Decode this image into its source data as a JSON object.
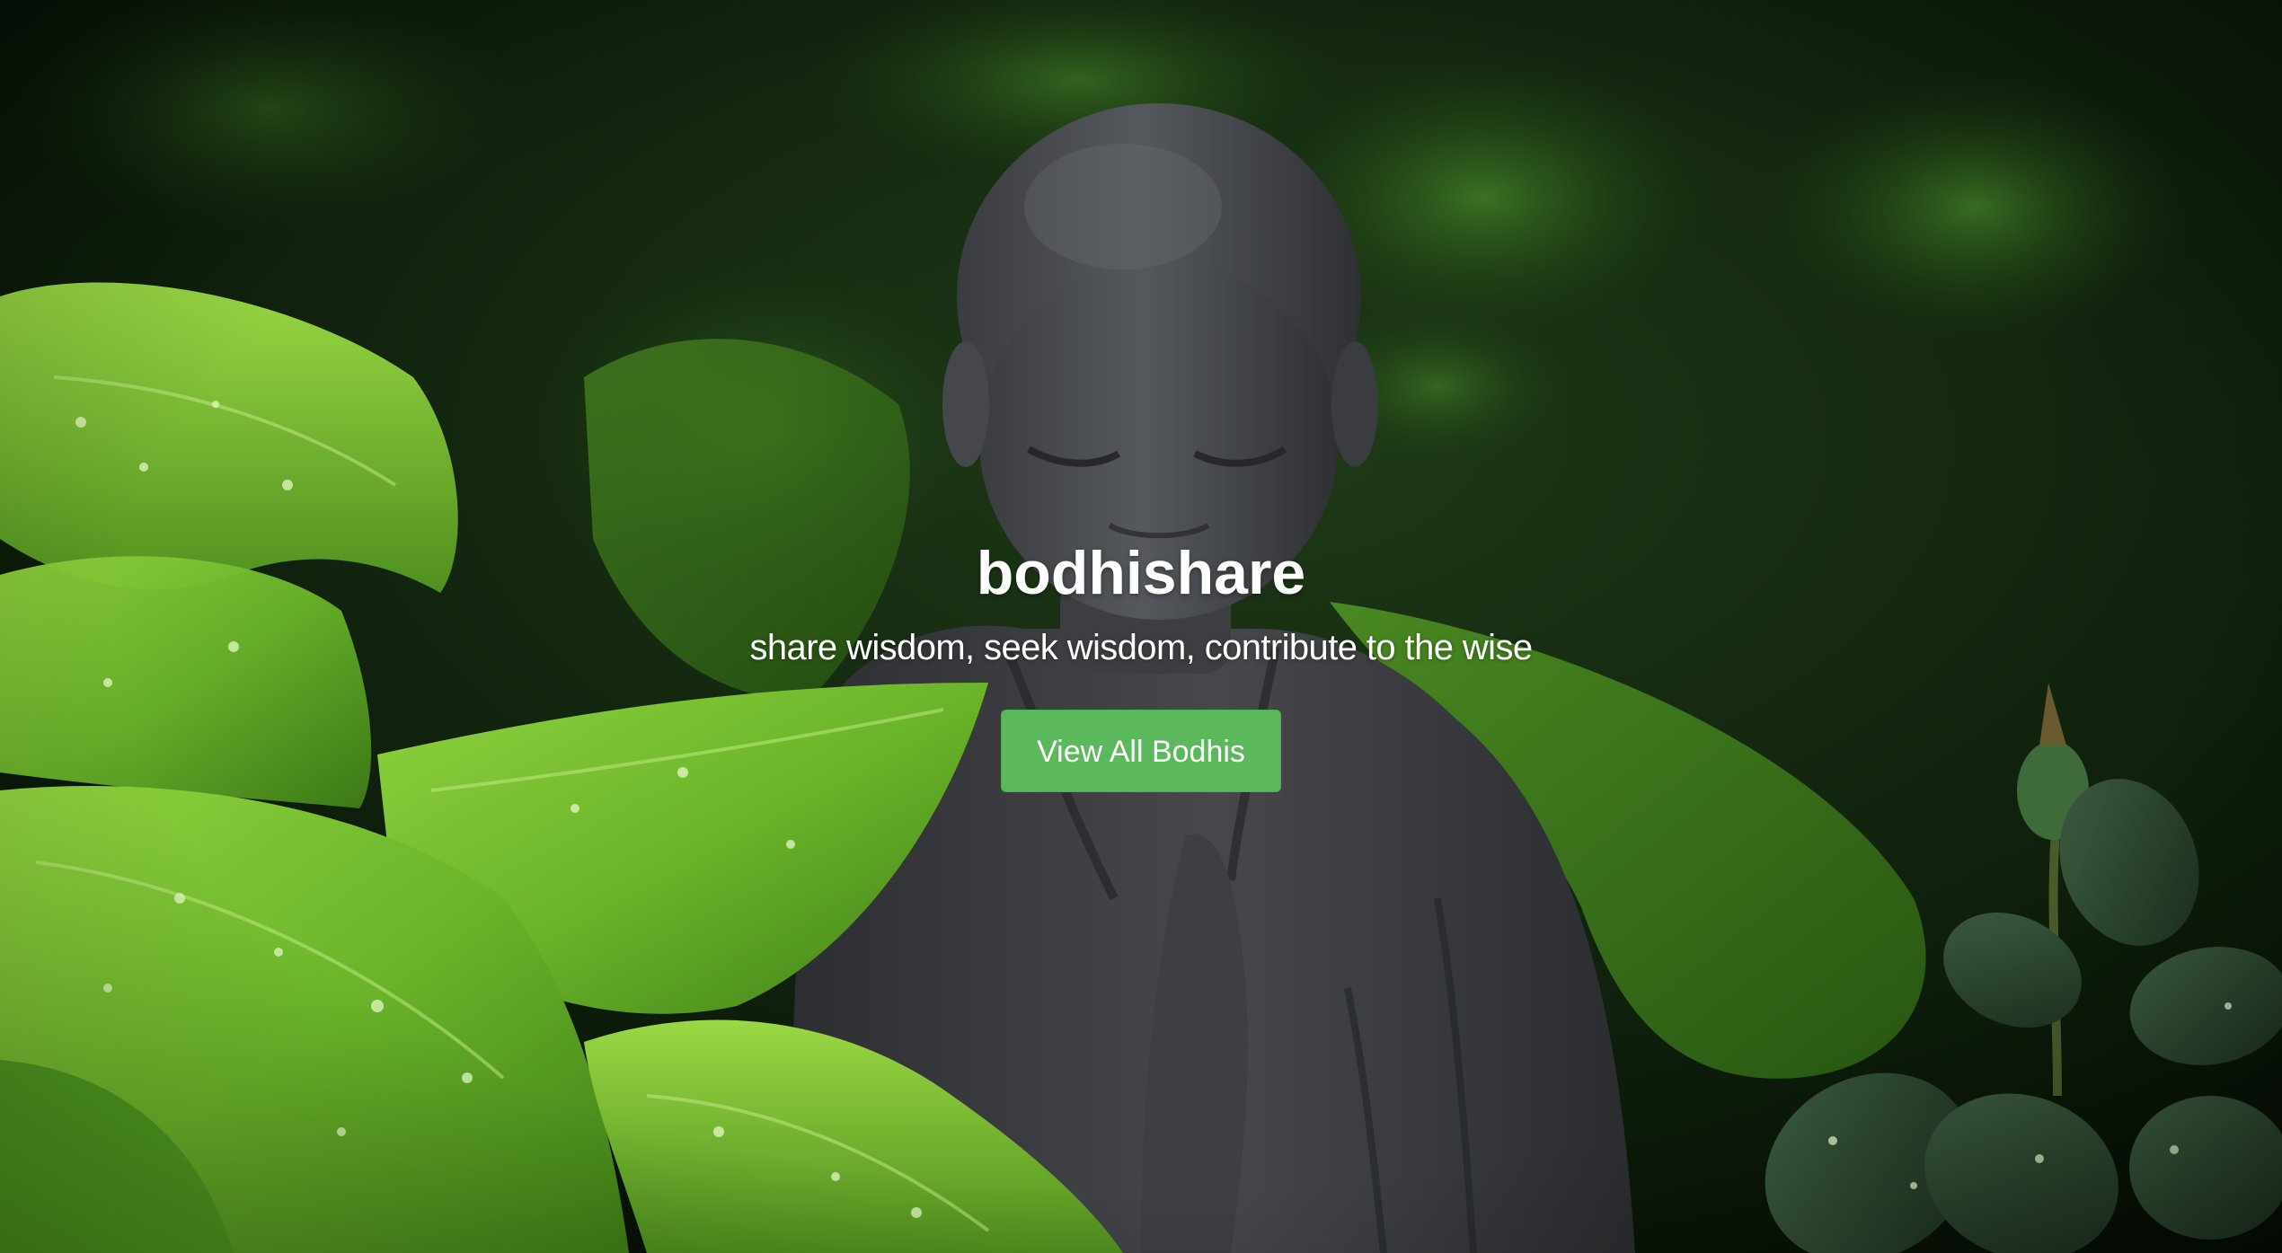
{
  "hero": {
    "title": "bodhishare",
    "tagline": "share wisdom, seek wisdom, contribute to the wise",
    "cta_label": "View All Bodhis",
    "cta_color": "#5cb85c"
  },
  "background": {
    "description_icon": "buddha-statue-garden-photo"
  }
}
